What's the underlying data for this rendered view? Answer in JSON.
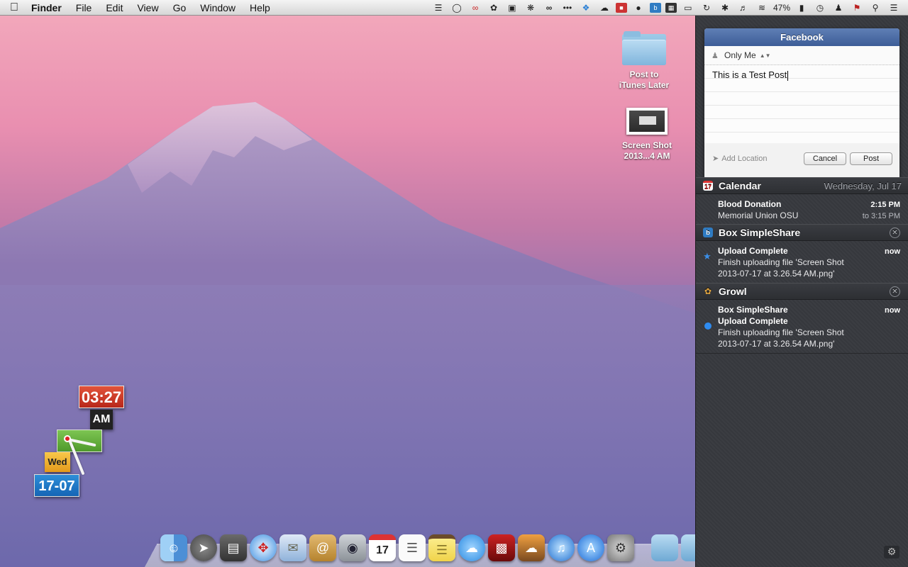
{
  "menubar": {
    "app_name": "Finder",
    "items": [
      "File",
      "Edit",
      "View",
      "Go",
      "Window",
      "Help"
    ],
    "battery": "47%"
  },
  "desktop": {
    "icons": [
      {
        "label": "Post to iTunes Later",
        "type": "folder"
      },
      {
        "label": "Screen Shot 2013...4 AM",
        "type": "screenshot"
      }
    ]
  },
  "clock_widget": {
    "time": "03:27",
    "ampm": "AM",
    "day": "Wed",
    "date": "17-07"
  },
  "facebook": {
    "title": "Facebook",
    "audience": "Only Me",
    "post_text": "This is a Test Post",
    "add_location": "Add Location",
    "cancel_label": "Cancel",
    "post_label": "Post"
  },
  "notifications": {
    "calendar": {
      "app": "Calendar",
      "date": "Wednesday, Jul 17",
      "event_title": "Blood Donation",
      "event_location": "Memorial Union OSU",
      "start": "2:15 PM",
      "end": "to 3:15 PM"
    },
    "box": {
      "app": "Box SimpleShare",
      "title": "Upload Complete",
      "line1": "Finish uploading file 'Screen Shot",
      "line2": "2013-07-17 at 3.26.54 AM.png'",
      "time": "now"
    },
    "growl": {
      "app": "Growl",
      "title1": "Box SimpleShare",
      "title2": "Upload Complete",
      "line1": "Finish uploading file 'Screen Shot",
      "line2": "2013-07-17 at 3.26.54 AM.png'",
      "time": "now"
    }
  },
  "colors": {
    "facebook_blue": "#3d5d97",
    "nc_background": "#3b3d42",
    "unread_dot": "#2e8bf0"
  },
  "dock": {
    "apps": [
      "finder-icon",
      "launchpad-icon",
      "photo-browser-icon",
      "safari-icon",
      "mail-icon",
      "contacts-icon",
      "facetime-icon",
      "calendar-icon",
      "reminders-icon",
      "notes-icon",
      "messages-icon",
      "photo-booth-icon",
      "iphoto-icon",
      "itunes-icon",
      "app-store-icon",
      "system-preferences-icon"
    ],
    "calendar_day": "17"
  }
}
